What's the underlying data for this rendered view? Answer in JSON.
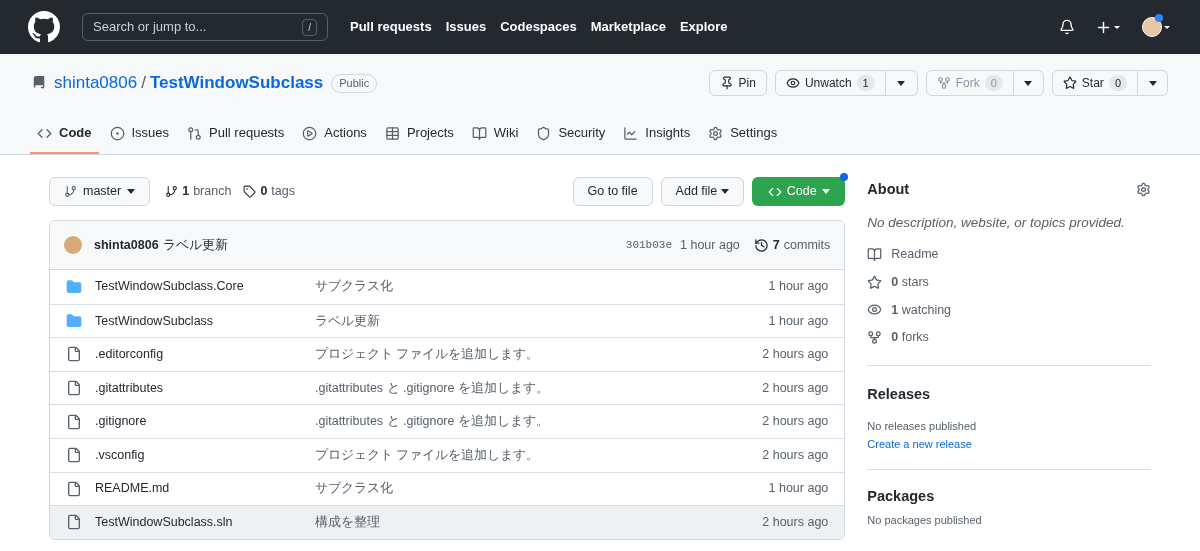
{
  "header": {
    "search_placeholder": "Search or jump to...",
    "search_key": "/",
    "nav": [
      "Pull requests",
      "Issues",
      "Codespaces",
      "Marketplace",
      "Explore"
    ]
  },
  "repo": {
    "owner": "shinta0806",
    "separator": "/",
    "name": "TestWindowSubclass",
    "visibility": "Public",
    "actions": [
      {
        "kind": "pin",
        "label": "Pin",
        "disabled": false
      },
      {
        "kind": "watch",
        "label": "Unwatch",
        "count": "1",
        "disabled": false
      },
      {
        "kind": "fork",
        "label": "Fork",
        "count": "0",
        "disabled": true
      },
      {
        "kind": "star",
        "label": "Star",
        "count": "0",
        "disabled": false
      }
    ]
  },
  "tabs": [
    {
      "label": "Code",
      "selected": true
    },
    {
      "label": "Issues",
      "selected": false
    },
    {
      "label": "Pull requests",
      "selected": false
    },
    {
      "label": "Actions",
      "selected": false
    },
    {
      "label": "Projects",
      "selected": false
    },
    {
      "label": "Wiki",
      "selected": false
    },
    {
      "label": "Security",
      "selected": false
    },
    {
      "label": "Insights",
      "selected": false
    },
    {
      "label": "Settings",
      "selected": false
    }
  ],
  "toolbar": {
    "branch": "master",
    "branches_count": "1",
    "branches_label": "branch",
    "tags_count": "0",
    "tags_label": "tags",
    "go_to_file": "Go to file",
    "add_file": "Add file",
    "code": "Code"
  },
  "latest_commit": {
    "author": "shinta0806",
    "message": "ラベル更新",
    "sha": "301b03e",
    "time": "1 hour ago",
    "commits_count": "7",
    "commits_label": "commits"
  },
  "files": [
    {
      "kind": "dir",
      "name": "TestWindowSubclass.Core",
      "message": "サブクラス化",
      "time": "1 hour ago",
      "selected": false
    },
    {
      "kind": "dir",
      "name": "TestWindowSubclass",
      "message": "ラベル更新",
      "time": "1 hour ago",
      "selected": false
    },
    {
      "kind": "file",
      "name": ".editorconfig",
      "message": "プロジェクト ファイルを追加します。",
      "time": "2 hours ago",
      "selected": false
    },
    {
      "kind": "file",
      "name": ".gitattributes",
      "message": ".gitattributes と .gitignore を追加します。",
      "time": "2 hours ago",
      "selected": false
    },
    {
      "kind": "file",
      "name": ".gitignore",
      "message": ".gitattributes と .gitignore を追加します。",
      "time": "2 hours ago",
      "selected": false
    },
    {
      "kind": "file",
      "name": ".vsconfig",
      "message": "プロジェクト ファイルを追加します。",
      "time": "2 hours ago",
      "selected": false
    },
    {
      "kind": "file",
      "name": "README.md",
      "message": "サブクラス化",
      "time": "1 hour ago",
      "selected": false
    },
    {
      "kind": "file",
      "name": "TestWindowSubclass.sln",
      "message": "構成を整理",
      "time": "2 hours ago",
      "selected": true
    }
  ],
  "about": {
    "title": "About",
    "description": "No description, website, or topics provided.",
    "stats": [
      {
        "label": "Readme"
      },
      {
        "count": "0",
        "label": "stars"
      },
      {
        "count": "1",
        "label": "watching"
      },
      {
        "count": "0",
        "label": "forks"
      }
    ]
  },
  "releases": {
    "title": "Releases",
    "text": "No releases published",
    "link": "Create a new release"
  },
  "packages": {
    "title": "Packages",
    "text": "No packages published"
  }
}
